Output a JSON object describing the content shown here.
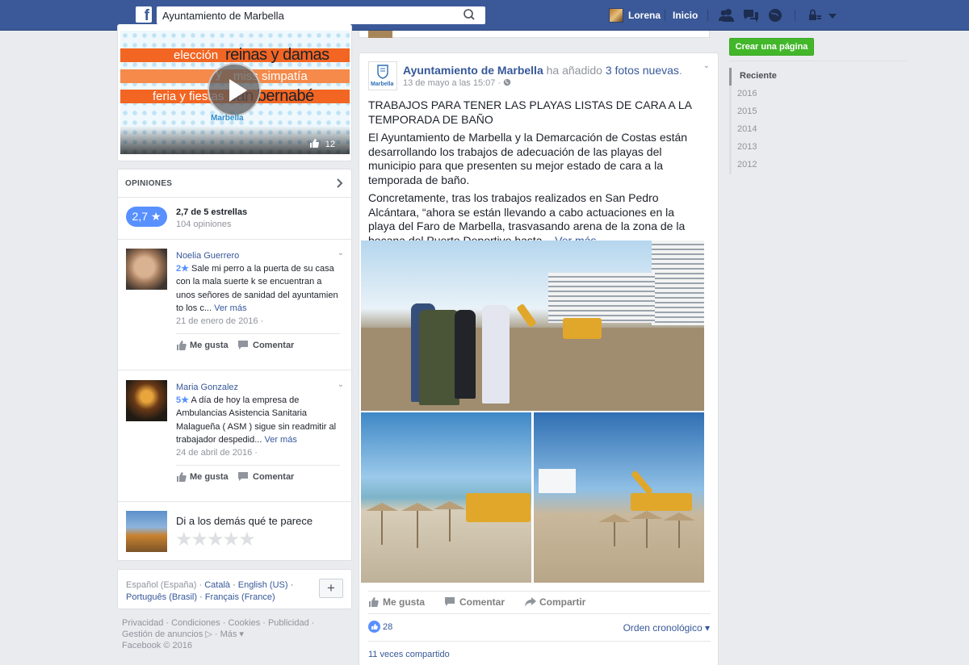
{
  "topbar": {
    "logo": "f",
    "search_value": "Ayuntamiento de Marbella",
    "user_name": "Lorena",
    "home_label": "Inicio",
    "icons": [
      "friend-requests-icon",
      "messages-icon",
      "notifications-icon",
      "privacy-shortcuts-icon",
      "account-menu-icon"
    ]
  },
  "video": {
    "line1": "elección",
    "line1b": "reinas y damas",
    "line2a": "y",
    "line2b": "miss simpatía",
    "line3a": "feria y fiestas",
    "line3b": "san bernabé",
    "seal": "Marbella",
    "likes": "12"
  },
  "reviews": {
    "heading": "OPINIONES",
    "rating_pill": "2,7 ★",
    "rating_text": "2,7 de 5 estrellas",
    "count_text": "104 opiniones",
    "items": [
      {
        "name": "Noelia Guerrero",
        "stars": "2★",
        "text": "Sale mi perro a la puerta de su casa con la mala suerte k se encuentran a unos señores de sanidad del ayuntamien to los c...",
        "more": "Ver más",
        "date": "21 de enero de 2016 ·",
        "like": "Me gusta",
        "comment": "Comentar"
      },
      {
        "name": "Maria Gonzalez",
        "stars": "5★",
        "text": "A día de hoy la empresa de Ambulancias Asistencia Sanitaria Malagueña ( ASM ) sigue sin readmitir al trabajador despedid...",
        "more": "Ver más",
        "date": "24 de abril de 2016 ·",
        "like": "Me gusta",
        "comment": "Comentar"
      }
    ],
    "prompt": "Di a los demás qué te parece",
    "stars_empty": "★★★★★"
  },
  "languages": {
    "current": "Español (España) · ",
    "others": "Català · English (US) · Português (Brasil) · Français (France)",
    "add": "+"
  },
  "footer": {
    "line1": "Privacidad · Condiciones · Cookies · Publicidad ·",
    "line2": "Gestión de anuncios ▷ · Más ▾",
    "line3": "Facebook © 2016"
  },
  "post": {
    "page_name": "Ayuntamiento de Marbella",
    "action_text": "ha añadido",
    "photos_link": "3 fotos nuevas",
    "period": ".",
    "timestamp": "13 de mayo a las 15:07 ·",
    "logo_text": "Marbella",
    "title": "TRABAJOS PARA TENER LAS PLAYAS LISTAS DE CARA A LA TEMPORADA DE BAÑO",
    "para1": "El Ayuntamiento de Marbella y la Demarcación de Costas están desarrollando los trabajos de adecuación de las playas del municipio para que presenten su mejor estado de cara a la temporada de baño.",
    "para2": "Concretamente, tras los trabajos realizados en San Pedro Alcántara, “ahora se están llevando a cabo actuaciones en la playa del Faro de Marbella, trasvasando arena de la zona de la bocana del Puerto Deportivo hasta...",
    "more": "Ver más",
    "like": "Me gusta",
    "comment": "Comentar",
    "share": "Compartir",
    "like_count": "28",
    "order": "Orden cronológico ▾",
    "shared": "11 veces compartido"
  },
  "sidebar": {
    "create_page": "Crear una página",
    "years": [
      "Reciente",
      "2016",
      "2015",
      "2014",
      "2013",
      "2012"
    ]
  },
  "colors": {
    "brand": "#3b5998",
    "link": "#365899",
    "green": "#42b72a",
    "rating": "#5890ff"
  }
}
